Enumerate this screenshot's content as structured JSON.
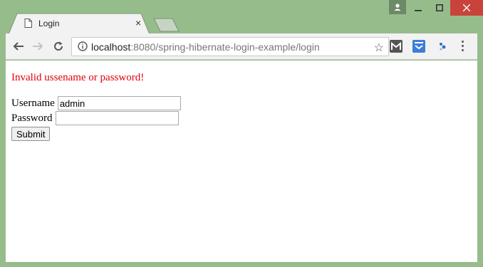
{
  "tab": {
    "title": "Login",
    "close": "×"
  },
  "omnibox": {
    "host": "localhost",
    "path": ":8080/spring-hibernate-login-example/login"
  },
  "form": {
    "error": "Invalid ussename or password!",
    "username_label": "Username",
    "username_value": "admin",
    "password_label": "Password",
    "password_value": "",
    "submit_label": "Submit"
  },
  "icons": {
    "back": "arrow-left",
    "forward": "arrow-right",
    "reload": "reload",
    "info": "info-circle",
    "star": "star",
    "ext1": "gmail-m",
    "ext2": "pocket",
    "ext3": "extension-dots",
    "menu": "vertical-dots"
  },
  "colors": {
    "frame": "#97bc8c",
    "error": "#e0000b",
    "close": "#c9433b"
  }
}
